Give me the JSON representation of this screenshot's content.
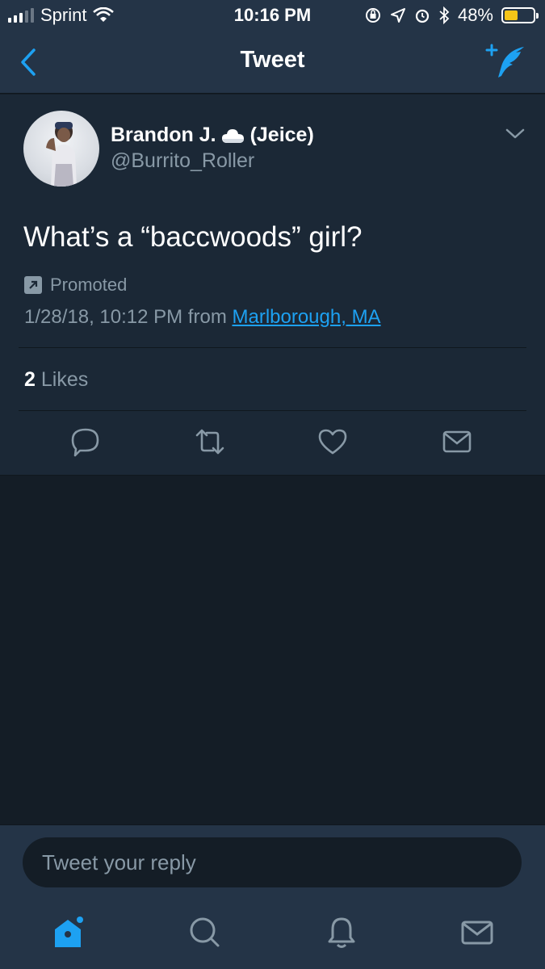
{
  "status_bar": {
    "carrier": "Sprint",
    "time": "10:16 PM",
    "battery_percent": "48%",
    "battery_level": 0.48,
    "battery_color": "#f5c518"
  },
  "nav": {
    "title": "Tweet",
    "back_icon": "chevron-left-icon",
    "compose_icon": "compose-quill-icon"
  },
  "tweet": {
    "author_name": "Brandon J.",
    "author_emoji": "cloud-icon",
    "author_nickname": "(Jeice)",
    "handle": "@Burrito_Roller",
    "text": "What’s a “baccwoods” girl?",
    "promoted_label": "Promoted",
    "timestamp": "1/28/18, 10:12 PM from ",
    "location": "Marlborough, MA",
    "likes_count": "2",
    "likes_label": "Likes"
  },
  "reply": {
    "placeholder": "Tweet your reply"
  },
  "colors": {
    "accent": "#1da1f2",
    "background": "#141d26",
    "card": "#1b2836",
    "bar": "#243447",
    "muted": "#8899a6"
  }
}
